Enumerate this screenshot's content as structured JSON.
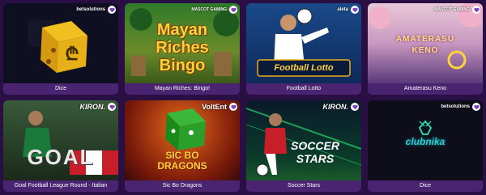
{
  "colors": {
    "background": "#2a0f45",
    "caption_bg": "#4a2470",
    "favorite": "#7a3fc2"
  },
  "games": [
    {
      "caption": "Dice",
      "provider": "betsolutions",
      "art_text": ""
    },
    {
      "caption": "Mayan Riches: Bingo!",
      "provider": "MASCOT GAMING",
      "art_text": "Mayan Riches Bingo"
    },
    {
      "caption": "Football Lotto",
      "provider": "aleta",
      "art_text": "Football Lotto"
    },
    {
      "caption": "Amaterasu Keno",
      "provider": "MASCOT GAMING",
      "art_text": "AMATERASU KENO"
    },
    {
      "caption": "Goal Football League Round - Italian",
      "provider": "KIRON.",
      "art_text": "GOAL"
    },
    {
      "caption": "Sic Bo Dragons",
      "provider": "VoltEnt",
      "art_text": "SIC BO DRAGONS"
    },
    {
      "caption": "Soccer Stars",
      "provider": "KIRON.",
      "art_text": "SOCCER STARS"
    },
    {
      "caption": "Dice",
      "provider": "betsolutions",
      "art_text": "clubnika"
    }
  ],
  "icons": {
    "favorite": "heart-icon",
    "dice": "dice-icon",
    "ball": "football-icon"
  }
}
